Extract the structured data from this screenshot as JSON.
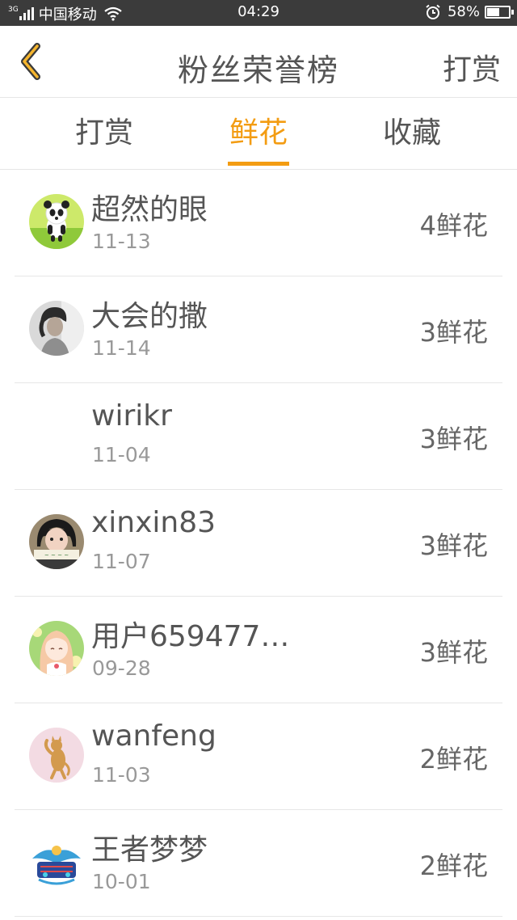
{
  "status_bar": {
    "network": "3G",
    "carrier": "中国移动",
    "time": "04:29",
    "battery_pct": "58%",
    "battery_level": 0.58,
    "icons": [
      "signal-icon",
      "wifi-icon",
      "alarm-icon",
      "battery-icon"
    ]
  },
  "header": {
    "title": "粉丝荣誉榜",
    "right_action": "打赏",
    "back_icon": "chevron-left-icon"
  },
  "tabs": {
    "active_index": 1,
    "items": [
      {
        "label": "打赏"
      },
      {
        "label": "鲜花"
      },
      {
        "label": "收藏"
      }
    ]
  },
  "colors": {
    "accent": "#f39c12",
    "text": "#555555",
    "muted": "#999999",
    "divider": "#e6e6e6",
    "status_bar": "#3b3b3b"
  },
  "list": [
    {
      "name": "超然的眼",
      "date": "11-13",
      "count": "4鲜花",
      "avatar": "panda-avatar"
    },
    {
      "name": "大会的撒",
      "date": "11-14",
      "count": "3鲜花",
      "avatar": "portrait-avatar"
    },
    {
      "name": "wirikr",
      "date": "11-04",
      "count": "3鲜花",
      "avatar": "none"
    },
    {
      "name": "xinxin83",
      "date": "11-07",
      "count": "3鲜花",
      "avatar": "girl-avatar"
    },
    {
      "name": "用户659477…",
      "date": "09-28",
      "count": "3鲜花",
      "avatar": "anime-avatar"
    },
    {
      "name": "wanfeng",
      "date": "11-03",
      "count": "2鲜花",
      "avatar": "cat-avatar"
    },
    {
      "name": "王者梦梦",
      "date": "10-01",
      "count": "2鲜花",
      "avatar": "game-avatar"
    }
  ]
}
